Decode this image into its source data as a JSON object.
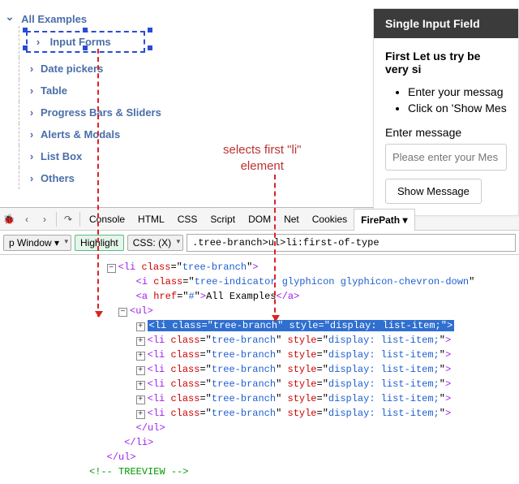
{
  "tree": {
    "root": "All Examples",
    "items": [
      "Input Forms",
      "Date pickers",
      "Table",
      "Progress Bars & Sliders",
      "Alerts & Modals",
      "List Box",
      "Others"
    ]
  },
  "annot": {
    "text1": "selects first \"li\"",
    "text2": "element"
  },
  "card": {
    "title": "Single Input Field",
    "lead": "First Let us try be very si",
    "b1": "Enter your messag",
    "b2": "Click on 'Show Mes",
    "label": "Enter message",
    "placeholder": "Please enter your Mes",
    "btn": "Show Message"
  },
  "toolbar": {
    "back": "‹",
    "fwd": "›",
    "step": "↷",
    "tabs": [
      "Console",
      "HTML",
      "CSS",
      "Script",
      "DOM",
      "Net",
      "Cookies"
    ],
    "active": "FirePath ▾"
  },
  "cssbar": {
    "window": "p Window ▾",
    "highlight": "Highlight",
    "mode": "CSS: (X)",
    "value": ".tree-branch>ul>li:first-of-type"
  },
  "dom": {
    "l0": {
      "cls": "tree-branch"
    },
    "l1": {
      "cls": "tree-indicator glyphicon glyphicon-chevron-down"
    },
    "l2": {
      "href": "#",
      "txt": "All Examples"
    },
    "sel": {
      "tag": "li",
      "cls": "tree-branch",
      "style": "display: list-item;"
    },
    "rep": {
      "tag": "li",
      "cls": "tree-branch",
      "style": "display: list-item;"
    },
    "comment": "<!-- TREEVIEW -->"
  }
}
